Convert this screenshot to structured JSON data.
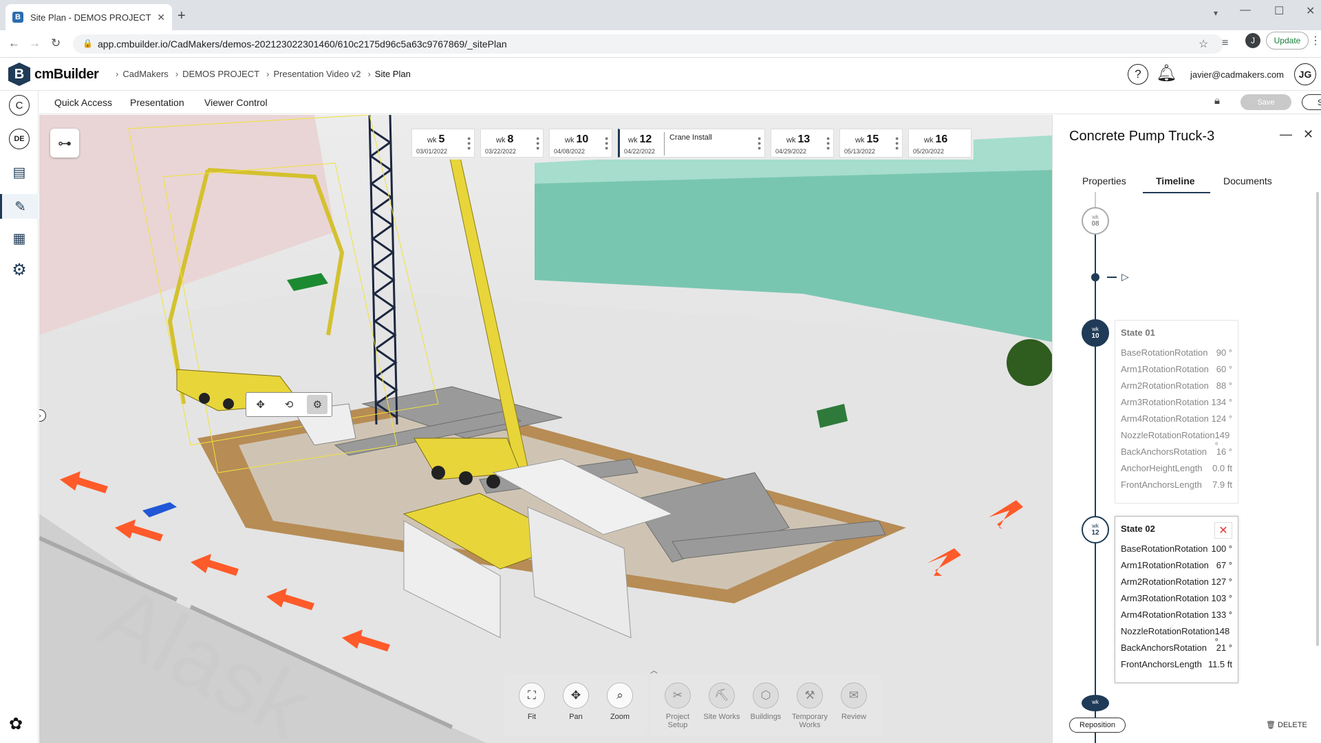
{
  "browser": {
    "tab_title": "Site Plan - DEMOS PROJECT | cm",
    "url": "app.cmbuilder.io/CadMakers/demos-202123022301460/610c2175d96c5a63c9767869/_sitePlan",
    "profile_initial": "J",
    "update_label": "Update"
  },
  "app": {
    "brand": "cmBuilder",
    "breadcrumb": [
      "CadMakers",
      "DEMOS PROJECT",
      "Presentation Video v2",
      "Site Plan"
    ],
    "help_icon_text": "?",
    "user_email": "javier@cadmakers.com",
    "user_initials": "JG"
  },
  "sidebar": {
    "c_label": "C",
    "de_label": "DE"
  },
  "subbar": {
    "menu": [
      "Quick Access",
      "Presentation",
      "Viewer Control"
    ],
    "save_label": "Save",
    "share_label": "Share"
  },
  "weeks": [
    {
      "prefix": "wk",
      "num": "5",
      "date": "03/01/2022"
    },
    {
      "prefix": "wk",
      "num": "8",
      "date": "03/22/2022"
    },
    {
      "prefix": "wk",
      "num": "10",
      "date": "04/08/2022"
    },
    {
      "prefix": "wk",
      "num": "12",
      "date": "04/22/2022",
      "event": "Crane Install"
    },
    {
      "prefix": "wk",
      "num": "13",
      "date": "04/29/2022"
    },
    {
      "prefix": "wk",
      "num": "15",
      "date": "05/13/2022"
    },
    {
      "prefix": "wk",
      "num": "16",
      "date": "05/20/2022"
    }
  ],
  "toolbar": {
    "view": [
      {
        "label": "Fit",
        "icon": "fit-icon"
      },
      {
        "label": "Pan",
        "icon": "pan-icon"
      },
      {
        "label": "Zoom",
        "icon": "zoom-icon"
      }
    ],
    "sections": [
      {
        "label1": "Project",
        "label2": "Setup",
        "icon": "project-setup-icon"
      },
      {
        "label1": "Site Works",
        "label2": "",
        "icon": "site-works-icon"
      },
      {
        "label1": "Buildings",
        "label2": "",
        "icon": "buildings-icon"
      },
      {
        "label1": "Temporary",
        "label2": "Works",
        "icon": "temporary-works-icon"
      },
      {
        "label1": "Review",
        "label2": "",
        "icon": "review-icon"
      }
    ]
  },
  "panel": {
    "title": "Concrete Pump Truck-3",
    "tabs": [
      "Properties",
      "Timeline",
      "Documents"
    ],
    "active_tab": "Timeline",
    "timeline": {
      "wk08": {
        "prefix": "wk",
        "num": "08"
      },
      "wk10": {
        "prefix": "wk",
        "num": "10"
      },
      "wk12": {
        "prefix": "wk",
        "num": "12"
      },
      "wk_next": {
        "prefix": "wk"
      }
    },
    "state01": {
      "title": "State 01",
      "rows": [
        {
          "name": "BaseRotationRotation",
          "value": "90 °"
        },
        {
          "name": "Arm1RotationRotation",
          "value": "60 °"
        },
        {
          "name": "Arm2RotationRotation",
          "value": "88 °"
        },
        {
          "name": "Arm3RotationRotation",
          "value": "134 °"
        },
        {
          "name": "Arm4RotationRotation",
          "value": "124 °"
        },
        {
          "name": "NozzleRotationRotation",
          "value": "149 °"
        },
        {
          "name": "BackAnchorsRotation",
          "value": "16 °"
        },
        {
          "name": "AnchorHeightLength",
          "value": "0.0 ft"
        },
        {
          "name": "FrontAnchorsLength",
          "value": "7.9 ft"
        }
      ]
    },
    "state02": {
      "title": "State 02",
      "rows": [
        {
          "name": "BaseRotationRotation",
          "value": "100 °"
        },
        {
          "name": "Arm1RotationRotation",
          "value": "67 °"
        },
        {
          "name": "Arm2RotationRotation",
          "value": "127 °"
        },
        {
          "name": "Arm3RotationRotation",
          "value": "103 °"
        },
        {
          "name": "Arm4RotationRotation",
          "value": "133 °"
        },
        {
          "name": "NozzleRotationRotation",
          "value": "148 °"
        },
        {
          "name": "BackAnchorsRotation",
          "value": "21 °"
        },
        {
          "name": "FrontAnchorsLength",
          "value": "11.5 ft"
        }
      ]
    },
    "reposition_label": "Reposition",
    "delete_label": "DELETE"
  },
  "scene": {
    "ground_text": "Alask"
  },
  "colors": {
    "brand": "#1f3b57",
    "crane_yellow": "#e8d53a",
    "arrow_red": "#ff5a2a",
    "green_wall": "#6bc4a8"
  }
}
